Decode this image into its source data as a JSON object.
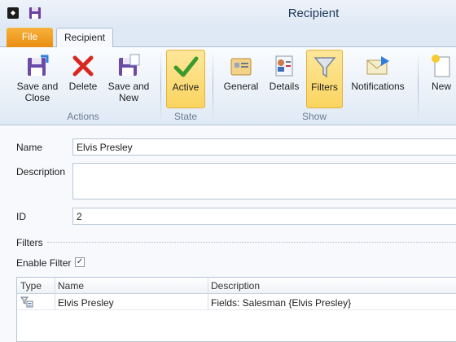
{
  "window": {
    "title": "Recipient"
  },
  "tabs": {
    "file": "File",
    "recipient": "Recipient"
  },
  "ribbon": {
    "buttons": {
      "save_close": "Save and Close",
      "delete": "Delete",
      "save_new": "Save and New",
      "active": "Active",
      "general": "General",
      "details": "Details",
      "filters": "Filters",
      "notifications": "Notifications",
      "new": "New"
    },
    "groups": {
      "actions": "Actions",
      "state": "State",
      "show": "Show"
    },
    "selected": [
      "Active",
      "Filters"
    ]
  },
  "form": {
    "name_label": "Name",
    "name_value": "Elvis Presley",
    "description_label": "Description",
    "description_value": "",
    "id_label": "ID",
    "id_value": "2",
    "filters_label": "Filters",
    "enable_filter_label": "Enable Filter",
    "enable_filter_checked": "✓"
  },
  "grid": {
    "columns": [
      "Type",
      "Name",
      "Description"
    ],
    "rows": [
      {
        "type_icon": "filter-list-icon",
        "name": "Elvis Presley",
        "description": "Fields: Salesman {Elvis Presley}"
      }
    ]
  },
  "colors": {
    "accent_file_tab": "#e98d12",
    "selected_button": "#fbd460",
    "ribbon_bg": "#dfe9f5"
  }
}
